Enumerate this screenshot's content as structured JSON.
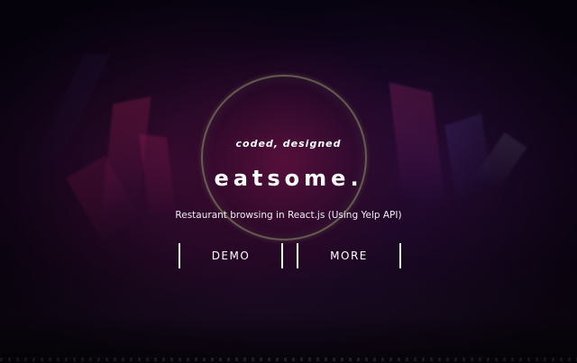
{
  "hero": {
    "tagline": "coded, designed",
    "title": "eatsome.",
    "subtitle": "Restaurant browsing in React.js (Using Yelp API)"
  },
  "actions": {
    "demo_label": "DEMO",
    "more_label": "MORE"
  },
  "colors": {
    "background": "#0b0418",
    "accent_glow": "#7a1446",
    "ring": "#969e6e",
    "text": "#ffffff"
  }
}
